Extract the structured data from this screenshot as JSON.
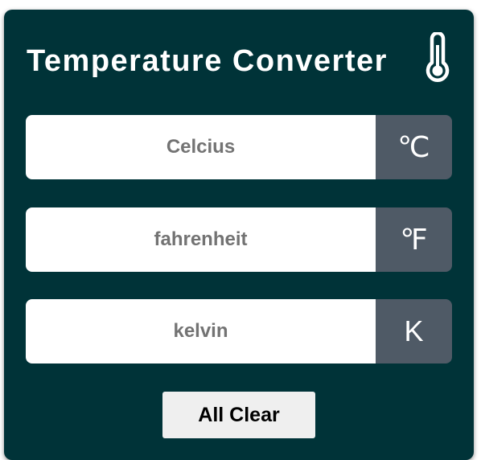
{
  "title": "Temperature Converter",
  "icons": {
    "title_icon": "thermometer-icon"
  },
  "fields": [
    {
      "placeholder": "Celcius",
      "value": "",
      "unit": "℃"
    },
    {
      "placeholder": "fahrenheit",
      "value": "",
      "unit": "℉"
    },
    {
      "placeholder": "kelvin",
      "value": "",
      "unit": "K"
    }
  ],
  "clear_button": {
    "label": "All Clear"
  },
  "colors": {
    "card_background": "#003338",
    "unit_background": "#4f5a66",
    "title_text": "#ffffff",
    "placeholder_text": "#737373",
    "button_background": "#efefef"
  }
}
